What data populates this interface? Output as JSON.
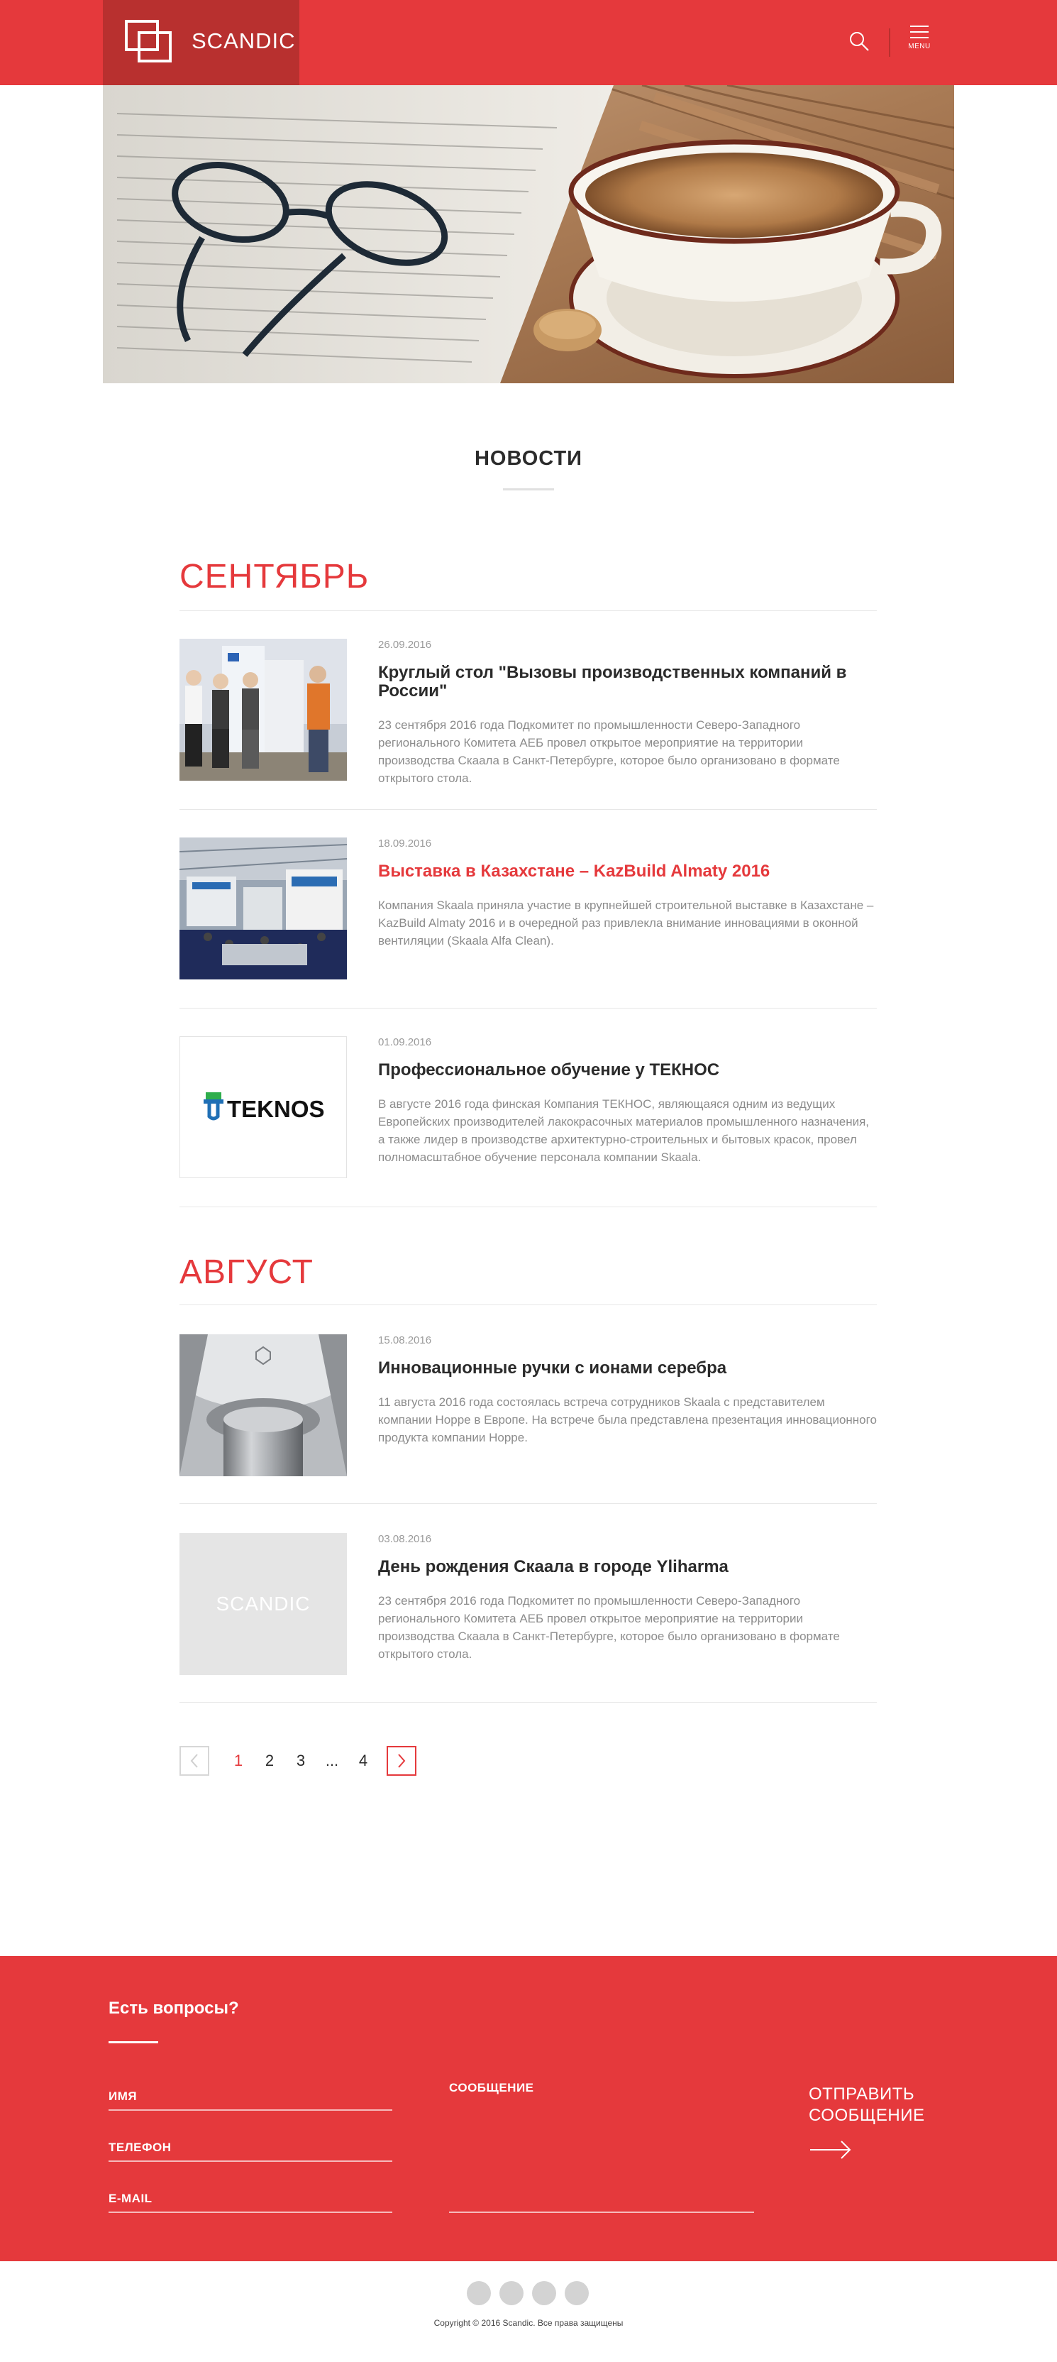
{
  "header": {
    "brand": "SCANDIC",
    "menu_label": "MENU"
  },
  "page": {
    "title": "НОВОСТИ"
  },
  "months": [
    {
      "label": "СЕНТЯБРЬ",
      "items": [
        {
          "date": "26.09.2016",
          "title": "Круглый стол \"Вызовы производственных компаний в России\"",
          "text": "23 сентября 2016 года Подкомитет по промышленности Северо-Западного регионального Комитета АЕБ провел открытое мероприятие на территории производства Скаала в Санкт-Петербурге, которое было организовано в формате открытого стола."
        },
        {
          "date": "18.09.2016",
          "title": "Выставка в Казахстане – KazBuild Almaty 2016",
          "text": "Компания Skaala приняла участие в крупнейшей строительной выставке в Казахстане – KazBuild Almaty 2016 и в очередной раз привлекла внимание инновациями в оконной вентиляции (Skaala Alfa Clean)."
        },
        {
          "date": "01.09.2016",
          "title": "Профессиональное обучение у ТЕКНОС",
          "text": "В августе 2016 года финская Компания ТЕКНОС, являющаяся одним из ведущих Европейских производителей лакокрасочных материалов промышленного назначения, а также лидер в производстве архитектурно-строительных и бытовых красок, провел полномасштабное обучение персонала компании Skaala.",
          "thumb_logo": "TEKNOS"
        }
      ]
    },
    {
      "label": "АВГУСТ",
      "items": [
        {
          "date": "15.08.2016",
          "title": "Инновационные ручки с ионами серебра",
          "text": "11 августа 2016 года состоялась встреча сотрудников Skaala с представителем компании Hoppe в Европе. На встрече была представлена презентация инновационного продукта компании Hoppe."
        },
        {
          "date": "03.08.2016",
          "title": "День рождения Скаала в городе Yliharma",
          "text": "23 сентября 2016 года Подкомитет по промышленности Северо-Западного регионального Комитета АЕБ провел открытое мероприятие на территории производства Скаала в Санкт-Петербурге, которое было организовано в формате открытого стола.",
          "thumb_logo": "SCANDIC"
        }
      ]
    }
  ],
  "pagination": {
    "pages": [
      "1",
      "2",
      "3",
      "...",
      "4"
    ],
    "current": "1"
  },
  "form": {
    "title": "Есть вопросы?",
    "name_label": "ИМЯ",
    "phone_label": "ТЕЛЕФОН",
    "email_label": "E-MAIL",
    "message_label": "СООБЩЕНИЕ",
    "send_line1": "ОТПРАВИТЬ",
    "send_line2": "СООБЩЕНИЕ"
  },
  "footer": {
    "copyright": "Copyright © 2016 Scandic. Все права защищены"
  },
  "colors": {
    "accent": "#e5393c",
    "accent_dark": "#b8302f"
  }
}
